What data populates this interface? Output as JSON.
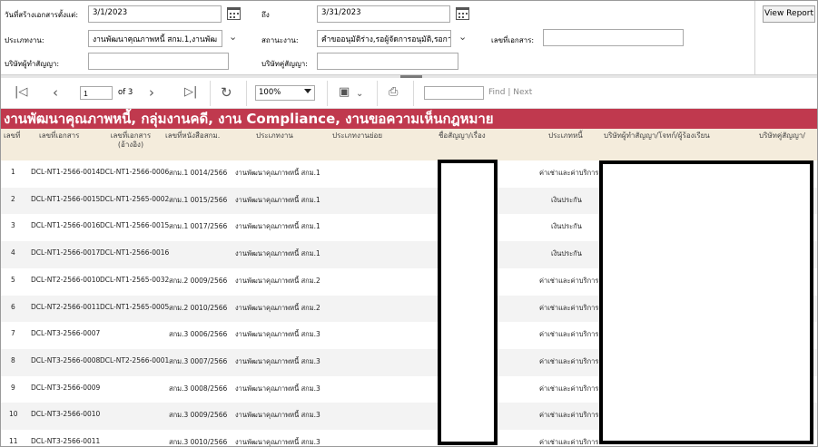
{
  "params": {
    "created_from_label": "วันที่สร้างเอกสารตั้งแต่:",
    "created_from_value": "3/1/2023",
    "to_label": "ถึง",
    "to_value": "3/31/2023",
    "type_label": "ประเภทงาน:",
    "type_value": "งานพัฒนาคุณภาพหนี้ สกม.1,งานพัฒ",
    "status_label": "สถานะงาน:",
    "status_value": "คำขออนุมัติร่าง,รอผู้จัดการอนุมัติ,รอการ",
    "doc_no_label": "เลขที่เอกสาร:",
    "doc_no_value": "",
    "contract_co_label": "บริษัทผู้ทำสัญญา:",
    "contract_co_value": "",
    "counterparty_label": "บริษัทคู่สัญญา:",
    "counterparty_value": ""
  },
  "view_report": "View Report",
  "toolbar": {
    "page_value": "1",
    "page_of": "of 3",
    "zoom": "100%",
    "find_value": "",
    "find": "Find",
    "sep": "|",
    "next": "Next"
  },
  "report_title": "งานพัฒนาคุณภาพหนี้, กลุ่มงานคดี, งาน Compliance, งานขอความเห็นกฎหมาย",
  "columns": [
    "เลขที่",
    "เลขที่เอกสาร",
    "เลขที่เอกสาร\n(อ้างอิง)",
    "เลขที่หนังสือสกม.",
    "ประเภทงาน",
    "ประเภทงานย่อย",
    "ชื่อสัญญา/เรื่อง",
    "ประเภทหนี้",
    "บริษัทผู้ทำสัญญา/โจทก์/ผู้ร้องเรียน",
    "บริษัทคู่สัญญา/"
  ],
  "rows": [
    {
      "no": "1",
      "doc": "DCL-NT1-2566-0014",
      "ref": "DCL-NT1-2566-0006",
      "letter": "สกม.1 0014/2566",
      "type": "งานพัฒนาคุณภาพหนี้ สกม.1",
      "debt": "ค่าเช่าและค่าบริการ"
    },
    {
      "no": "2",
      "doc": "DCL-NT1-2566-0015",
      "ref": "DCL-NT1-2565-0002",
      "letter": "สกม.1 0015/2566",
      "type": "งานพัฒนาคุณภาพหนี้ สกม.1",
      "debt": "เงินประกัน"
    },
    {
      "no": "3",
      "doc": "DCL-NT1-2566-0016",
      "ref": "DCL-NT1-2566-0015",
      "letter": "สกม.1 0017/2566",
      "type": "งานพัฒนาคุณภาพหนี้ สกม.1",
      "debt": "เงินประกัน"
    },
    {
      "no": "4",
      "doc": "DCL-NT1-2566-0017",
      "ref": "DCL-NT1-2566-0016",
      "letter": "",
      "type": "งานพัฒนาคุณภาพหนี้ สกม.1",
      "debt": "เงินประกัน"
    },
    {
      "no": "5",
      "doc": "DCL-NT2-2566-0010",
      "ref": "DCL-NT1-2565-0032",
      "letter": "สกม.2 0009/2566",
      "type": "งานพัฒนาคุณภาพหนี้ สกม.2",
      "debt": "ค่าเช่าและค่าบริการ"
    },
    {
      "no": "6",
      "doc": "DCL-NT2-2566-0011",
      "ref": "DCL-NT1-2565-0005",
      "letter": "สกม.2 0010/2566",
      "type": "งานพัฒนาคุณภาพหนี้ สกม.2",
      "debt": "ค่าเช่าและค่าบริการ"
    },
    {
      "no": "7",
      "doc": "DCL-NT3-2566-0007",
      "ref": "",
      "letter": "สกม.3 0006/2566",
      "type": "งานพัฒนาคุณภาพหนี้ สกม.3",
      "debt": "ค่าเช่าและค่าบริการ"
    },
    {
      "no": "8",
      "doc": "DCL-NT3-2566-0008",
      "ref": "DCL-NT2-2566-0001",
      "letter": "สกม.3 0007/2566",
      "type": "งานพัฒนาคุณภาพหนี้ สกม.3",
      "debt": "ค่าเช่าและค่าบริการ"
    },
    {
      "no": "9",
      "doc": "DCL-NT3-2566-0009",
      "ref": "",
      "letter": "สกม.3 0008/2566",
      "type": "งานพัฒนาคุณภาพหนี้ สกม.3",
      "debt": "ค่าเช่าและค่าบริการ"
    },
    {
      "no": "10",
      "doc": "DCL-NT3-2566-0010",
      "ref": "",
      "letter": "สกม.3 0009/2566",
      "type": "งานพัฒนาคุณภาพหนี้ สกม.3",
      "debt": "ค่าเช่าและค่าบริการ"
    },
    {
      "no": "11",
      "doc": "DCL-NT3-2566-0011",
      "ref": "",
      "letter": "สกม.3 0010/2566",
      "type": "งานพัฒนาคุณภาพหนี้ สกม.3",
      "debt": "ค่าเช่าและค่าบริการ"
    }
  ],
  "icons": {
    "first_page": "first-page-icon",
    "prev_page": "prev-page-icon",
    "next_page": "next-page-icon",
    "last_page": "last-page-icon",
    "refresh": "refresh-icon",
    "save": "save-icon",
    "print": "print-icon",
    "calendar": "calendar-icon",
    "chevron": "chevron-down-icon"
  },
  "colors": {
    "banner": "#c0394e",
    "header_bg": "#f4ecdc",
    "alt_row": "#f3f3f3"
  }
}
